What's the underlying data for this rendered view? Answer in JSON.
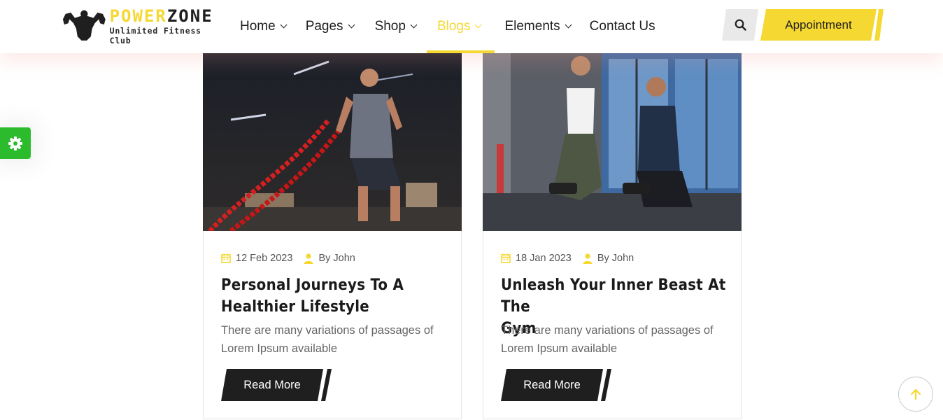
{
  "brand": {
    "name_part1": "POWER",
    "name_part2": "ZONE",
    "tagline": "Unlimited Fitness Club",
    "accent_color": "#f5d832"
  },
  "nav": {
    "items": [
      {
        "label": "Home",
        "has_dropdown": true,
        "active": false
      },
      {
        "label": "Pages",
        "has_dropdown": true,
        "active": false
      },
      {
        "label": "Shop",
        "has_dropdown": true,
        "active": false
      },
      {
        "label": "Blogs",
        "has_dropdown": true,
        "active": true
      },
      {
        "label": "Elements",
        "has_dropdown": true,
        "active": false
      },
      {
        "label": "Contact Us",
        "has_dropdown": false,
        "active": false
      }
    ],
    "search_icon": "search-icon",
    "appointment_label": "Appointment"
  },
  "settings": {
    "icon": "gear-icon",
    "color": "#2cbb2c"
  },
  "posts": [
    {
      "date": "12 Feb 2023",
      "author": "By John",
      "title_line1": "Personal Journeys To A",
      "title_line2": "Healthier Lifestyle",
      "excerpt": "There are many variations of passages of Lorem Ipsum available",
      "read_more": "Read More"
    },
    {
      "date": "18 Jan 2023",
      "author": "By John",
      "title_line1": "Unleash Your Inner Beast At The",
      "title_line2": "Gym",
      "excerpt": "There are many variations of passages of Lorem Ipsum available",
      "read_more": "Read More"
    }
  ],
  "scroll_top": {
    "icon": "arrow-up-icon"
  }
}
